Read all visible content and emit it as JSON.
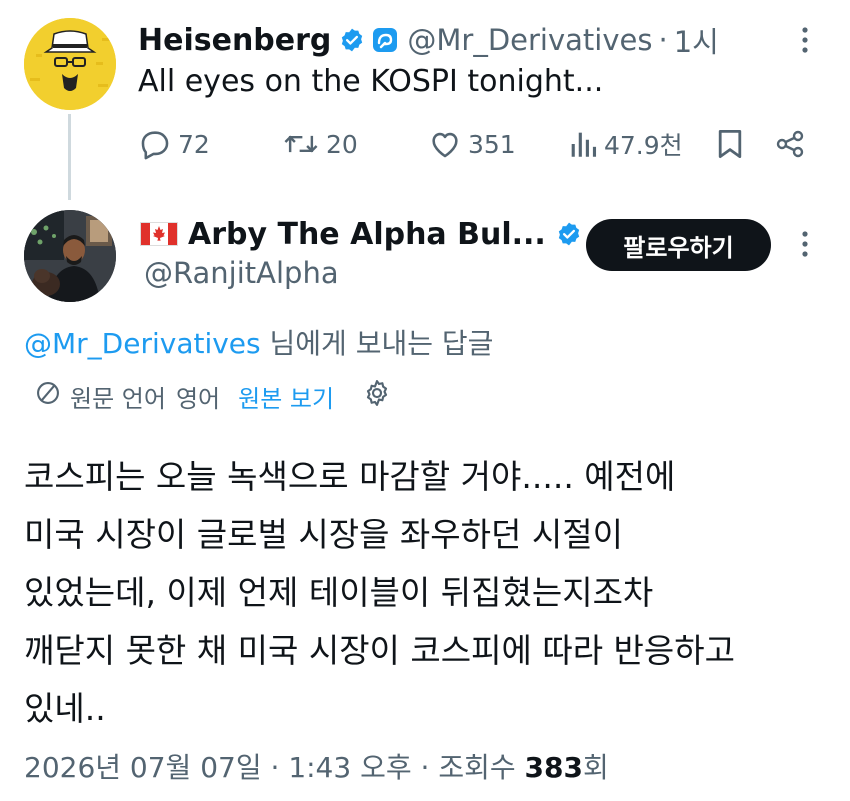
{
  "parent_tweet": {
    "display_name": "Heisenberg",
    "handle": "@Mr_Derivatives",
    "separator": "·",
    "time_ago": "1시",
    "text": "All eyes on the KOSPI tonight...",
    "stats": {
      "replies": "72",
      "reposts": "20",
      "likes": "351",
      "views": "47.9천"
    },
    "icons": [
      "verified-badge-icon",
      "affiliate-badge-icon",
      "more-options-icon",
      "reply-icon",
      "repost-icon",
      "like-icon",
      "views-icon",
      "bookmark-icon",
      "share-icon"
    ]
  },
  "reply_tweet": {
    "flag_icon": "canada-flag-icon",
    "display_name": "Arby The Alpha Bul...",
    "handle": "@RanjitAlpha",
    "follow_label": "팔로우하기",
    "reply_to_mention": "@Mr_Derivatives",
    "reply_to_suffix": " 님에게 보내는 답글",
    "translation": {
      "label": "원문 언어",
      "language": "영어",
      "show_original": "원본 보기"
    },
    "text_lines": [
      "코스피는 오늘 녹색으로 마감할 거야..... 예전에",
      "미국 시장이 글로벌 시장을 좌우하던 시절이",
      "있었는데, 이제 언제 테이블이 뒤집혔는지조차",
      "깨닫지 못한 채 미국 시장이 코스피에 따라 반응하고",
      "있네.."
    ],
    "meta": {
      "date": "2026년 07월 07일",
      "sep1": " · ",
      "time": "1:43 오후",
      "sep2": " · ",
      "views_label": "조회수 ",
      "views_count": "383",
      "views_suffix": "회"
    }
  },
  "colors": {
    "accent": "#1d9bf0",
    "text_primary": "#0f1419",
    "text_secondary": "#536471",
    "follow_button_bg": "#0f1419",
    "thread_line": "#cfd9de",
    "avatar_yellow": "#f2cf2e"
  }
}
